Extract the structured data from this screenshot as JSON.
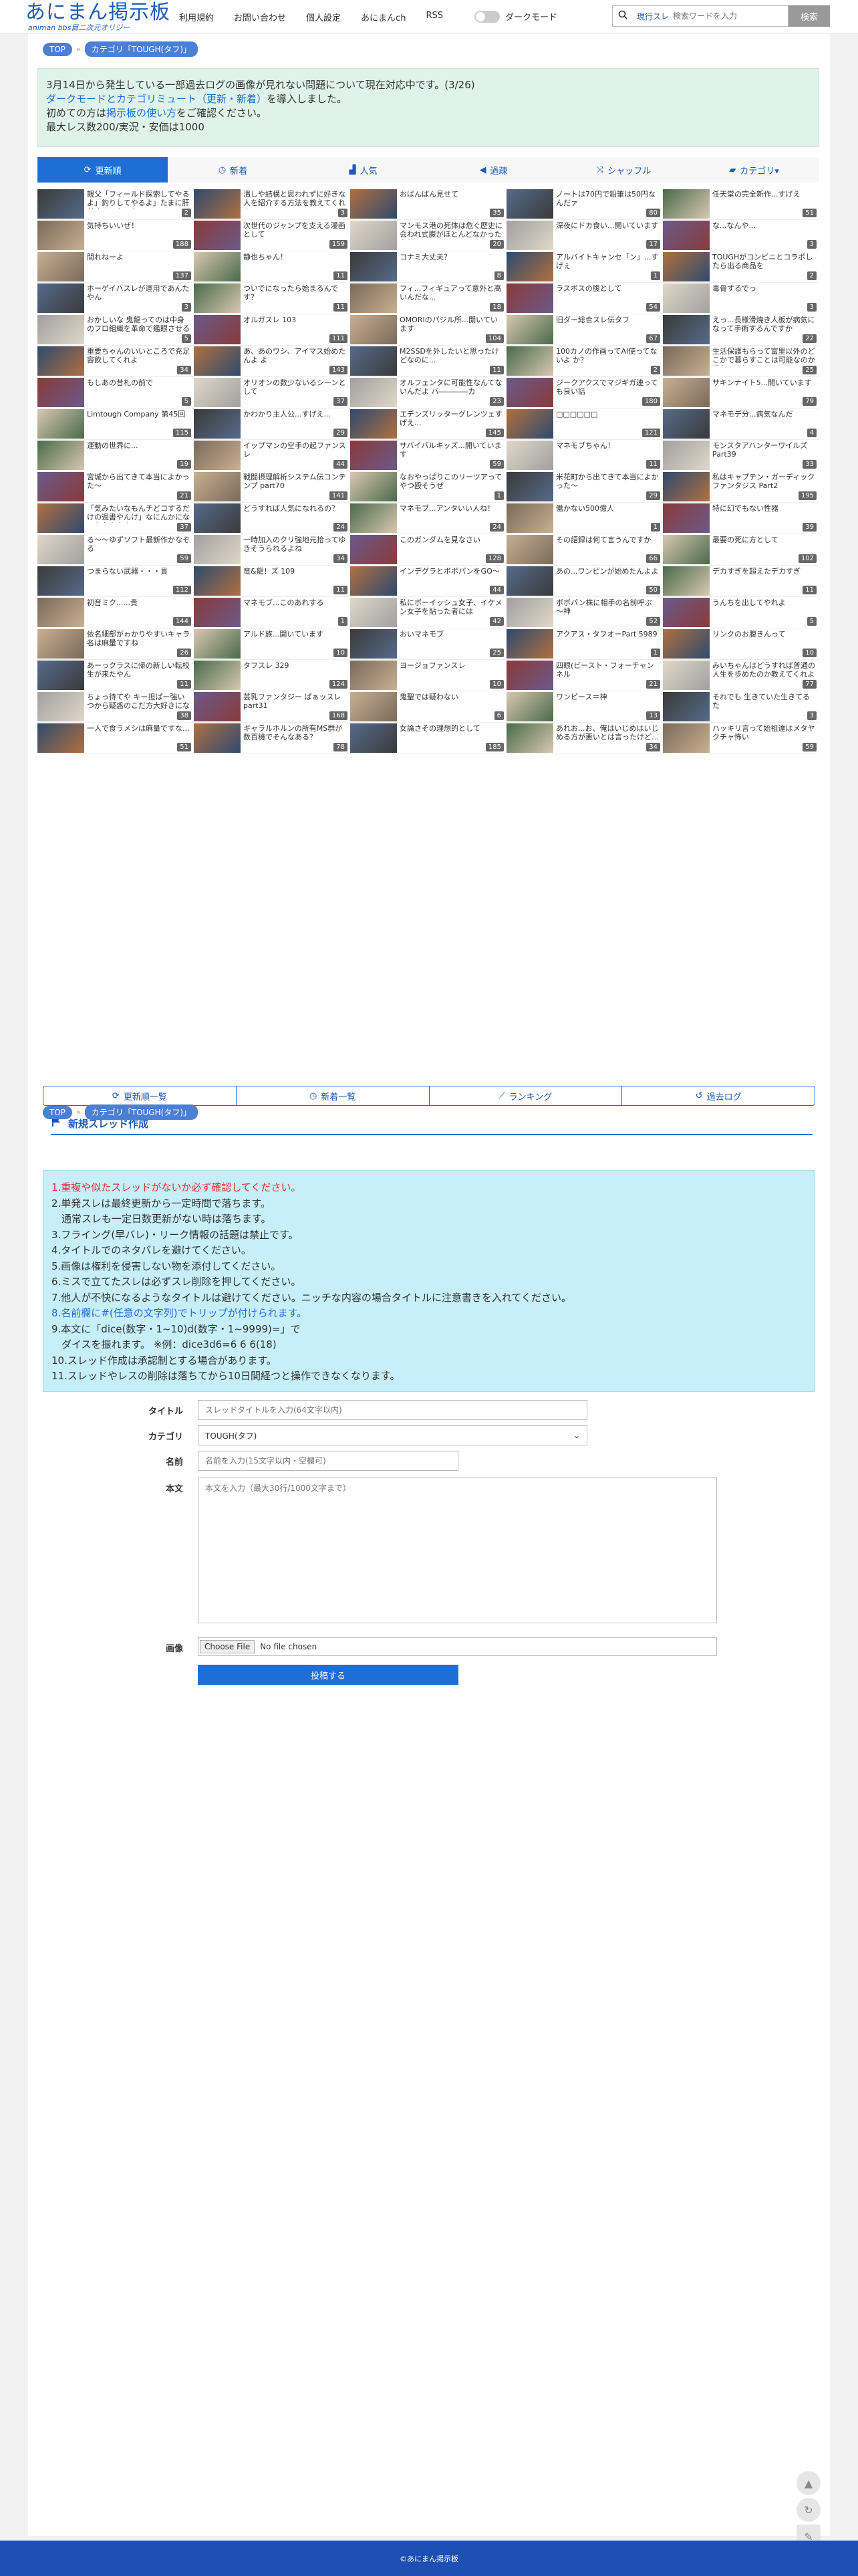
{
  "header": {
    "logo_main": "あにまん掲示板",
    "logo_sub": "animan bbs目二次元オリジー",
    "nav": [
      "利用規約",
      "お問い合わせ",
      "個人設定",
      "あにまんch",
      "RSS"
    ],
    "dark_mode_label": "ダークモード",
    "search_scope": "現行スレ",
    "search_placeholder": "検索ワードを入力",
    "search_button": "検索"
  },
  "breadcrumb": {
    "top": "TOP",
    "category": "カテゴリ「TOUGH(タフ)」"
  },
  "notice": {
    "line1": "3月14日から発生している一部過去ログの画像が見れない問題について現在対応中です。(3/26)",
    "line2_link": "ダークモードとカテゴリミュート（更新・新着）",
    "line2_rest": "を導入しました。",
    "line3_pre": "初めての方は",
    "line3_link": "掲示板の使い方",
    "line3_post": "をご確認ください。",
    "line4": "最大レス数200/実況・安価は1000"
  },
  "tabs": [
    {
      "label": "更新順",
      "icon": "refresh-icon"
    },
    {
      "label": "新着",
      "icon": "clock-icon"
    },
    {
      "label": "人気",
      "icon": "bar-chart-icon"
    },
    {
      "label": "過疎",
      "icon": "speaker-icon"
    },
    {
      "label": "シャッフル",
      "icon": "shuffle-icon"
    },
    {
      "label": "カテゴリ▾",
      "icon": "folder-icon"
    }
  ],
  "threads": [
    {
      "t": "親父「フィールド探索してやるよ」釣りしてやるよ」たまに肝付するのもワケ?",
      "c": "2"
    },
    {
      "t": "潰しや結構と思われずに好きな人を紹介する方法を教えてくれよ",
      "c": "3"
    },
    {
      "t": "おばんばん見せて",
      "c": "35"
    },
    {
      "t": "ノートは70円で鉛筆は50円なんだァ",
      "c": "80"
    },
    {
      "t": "任天堂の完全新作...すげえ",
      "c": "51"
    },
    {
      "t": "気持ちいいぜ！",
      "c": "188"
    },
    {
      "t": "次世代のジャンプを支える漫画として",
      "c": "159"
    },
    {
      "t": "マンモス港の死体は危ぐ歴史に会われ式腹がほとんどなかったらしい",
      "c": "20"
    },
    {
      "t": "深夜にドカ食い...開いています",
      "c": "17"
    },
    {
      "t": "な...なんや...",
      "c": "3"
    },
    {
      "t": "間れねーよ",
      "c": "137"
    },
    {
      "t": "静也ちゃん！",
      "c": "11"
    },
    {
      "t": "コナミ大丈夫？",
      "c": "8"
    },
    {
      "t": "アルバイトキャンセ「ン」...すげぇ",
      "c": "1"
    },
    {
      "t": "TOUGHがコンビニとコラボしたら出る商品を",
      "c": "2"
    },
    {
      "t": "ホーゲイハスレが運用であんたやん",
      "c": "3"
    },
    {
      "t": "ついでになったら始まるんです？",
      "c": "11"
    },
    {
      "t": "フィ...フィギュアって意外と高いんだな...",
      "c": "18"
    },
    {
      "t": "ラスボスの腹として",
      "c": "54"
    },
    {
      "t": "毒骨するでっ",
      "c": "3"
    },
    {
      "t": "おかしいな 鬼龍ってのは中身のフロ組織を革命で鑑眼させるんだ？",
      "c": "5"
    },
    {
      "t": "オルガスレ 103",
      "c": "111"
    },
    {
      "t": "OMORIのパジル所...開いています",
      "c": "104"
    },
    {
      "t": "旧ダー総合スレ伝タフ",
      "c": "67"
    },
    {
      "t": "えっ...長様滑焼き人板が病気になって手術するんですか",
      "c": "22"
    },
    {
      "t": "重要ちゃんのいいところで充足容飲してくれよ",
      "c": "34"
    },
    {
      "t": "あ、あのワシ、アイマス始めたんよ よ",
      "c": "143"
    },
    {
      "t": "M2SSDを外したいと思ったけどなのに...",
      "c": "11"
    },
    {
      "t": "100カノの作画ってAI使ってないよ か？",
      "c": "2"
    },
    {
      "t": "生活保護もらって富里以外のどこかで暮らすことは可能なのか教えてくれよ",
      "c": "25"
    },
    {
      "t": "もしあの昔札の前で",
      "c": "5"
    },
    {
      "t": "オリオンの数少ないるシーンとして",
      "c": "37"
    },
    {
      "t": "オルフェンタに可能性なんてないんだよ バ――――カ",
      "c": "23"
    },
    {
      "t": "ジークアクスでマジギガ連っても良い話",
      "c": "180"
    },
    {
      "t": "サキンナイト5...開いています",
      "c": "79"
    },
    {
      "t": "Limtough Company 第45回",
      "c": "115"
    },
    {
      "t": "かわかり主人公...すげえ...",
      "c": "29"
    },
    {
      "t": "エデンズリッターグレンツェすげえ...",
      "c": "145"
    },
    {
      "t": "□□□□□□",
      "c": "121"
    },
    {
      "t": "マネモデ分...病気なんだ",
      "c": "4"
    },
    {
      "t": "運動の世界に...",
      "c": "19"
    },
    {
      "t": "イップマンの空手の起ファンスレ",
      "c": "44"
    },
    {
      "t": "サバイバルキッズ...開いています",
      "c": "59"
    },
    {
      "t": "マネモブちゃん！",
      "c": "11"
    },
    {
      "t": "モンスタアハンターワイルズ Part39",
      "c": "33"
    },
    {
      "t": "宮城から出てきて本当によかった～",
      "c": "21"
    },
    {
      "t": "戦闘摂理解析システム伝コンテンプ part70",
      "c": "141"
    },
    {
      "t": "なおやっぱりこのリーツアってやつ殴そうぜ",
      "c": "1"
    },
    {
      "t": "米花町から出てきて本当によかった～",
      "c": "29"
    },
    {
      "t": "私はキャプテン・ガーディックファンタジス Part2",
      "c": "195"
    },
    {
      "t": "「気みたいなもんチどコするだけの週書やんけ」なにんかになったもんやん",
      "c": "37"
    },
    {
      "t": "どうすれば人気になれるの？",
      "c": "24"
    },
    {
      "t": "マネモブ...アンタいい人ね！",
      "c": "24"
    },
    {
      "t": "働かない500億人",
      "c": "1"
    },
    {
      "t": "特に幻でもない性器",
      "c": "39"
    },
    {
      "t": "る～～ゆずソフト最新作かなぞる",
      "c": "59"
    },
    {
      "t": "一時加入のクリ強地元拾ってゆきそうられるよね",
      "c": "34"
    },
    {
      "t": "このガンダムを見なさい",
      "c": "128"
    },
    {
      "t": "その語録は何て言うんですか",
      "c": "66"
    },
    {
      "t": "最要の死に方として",
      "c": "102"
    },
    {
      "t": "つまらない武器・・・貴",
      "c": "112"
    },
    {
      "t": "竜&龍！ズ 109",
      "c": "11"
    },
    {
      "t": "インデグラとボボパンをGO～",
      "c": "44"
    },
    {
      "t": "あの...ワンピンが始めたんよよ",
      "c": "50"
    },
    {
      "t": "デカすぎを超えたデカすぎ",
      "c": "11"
    },
    {
      "t": "初音ミク......貴",
      "c": "144"
    },
    {
      "t": "マネモブ...このあれする",
      "c": "1"
    },
    {
      "t": "私にボーイッシュ女子、イケメン女子を貼った者には",
      "c": "42"
    },
    {
      "t": "ボボパン株に相手の名前呼ぶ～神",
      "c": "52"
    },
    {
      "t": "うんちを出してやれよ",
      "c": "5"
    },
    {
      "t": "依名細部がゎかりやすいキャラ名は麻量ですね",
      "c": "26"
    },
    {
      "t": "アルド族...開いています",
      "c": "10"
    },
    {
      "t": "おいマネモブ",
      "c": "25"
    },
    {
      "t": "アクアス・タフオーPart 5989",
      "c": "1"
    },
    {
      "t": "リンクのお腹きんって",
      "c": "10"
    },
    {
      "t": "あーっクラスに帰の新しい転校生が来たやん",
      "c": "11"
    },
    {
      "t": "タフスレ 329",
      "c": "124"
    },
    {
      "t": "ヨージョファンスレ",
      "c": "10"
    },
    {
      "t": "四眼(ビースト・フォーチャンネル",
      "c": "21"
    },
    {
      "t": "みいちゃんはどうすれば普通の人生を歩めたのか教えてくれよ",
      "c": "77"
    },
    {
      "t": "ちょっ待てや キー担ぱー強いつから疑惑のこだ方大好きになったんや",
      "c": "38"
    },
    {
      "t": "芸乳ファンタジー ぱぁッスレpart31",
      "c": "168"
    },
    {
      "t": "鬼聖では疑わない",
      "c": "6"
    },
    {
      "t": "ワンピース＝神",
      "c": "13"
    },
    {
      "t": "それでも 生きていた生きてるた",
      "c": "3"
    },
    {
      "t": "一人で食うメシは麻量ですな...",
      "c": "51"
    },
    {
      "t": "ギャラルホルンの所有MS群が数百機でそんなある？",
      "c": "78"
    },
    {
      "t": "女論さその理想的として",
      "c": "185"
    },
    {
      "t": "あれお...お、俺はいじめはいじめる方が悪いとは言ったけど...",
      "c": "34"
    },
    {
      "t": "ハッキリ言って始祖達はメタヤクチャ怖い",
      "c": "59"
    }
  ],
  "bottom_links": [
    {
      "label": "更新順一覧",
      "icon": "refresh-icon"
    },
    {
      "label": "新着一覧",
      "icon": "clock-icon"
    },
    {
      "label": "ランキング",
      "icon": "chart-icon"
    },
    {
      "label": "過去ログ",
      "icon": "history-icon"
    }
  ],
  "new_thread": {
    "title": "新規スレッド作成",
    "rules": [
      {
        "text": "1.重複や似たスレッドがないか必ず確認してください。",
        "style": "red"
      },
      {
        "text": "2.単発スレは最終更新から一定時間で落ちます。",
        "style": ""
      },
      {
        "text": "　通常スレも一定日数更新がない時は落ちます。",
        "style": ""
      },
      {
        "text": "3.フライング(早バレ)・リーク情報の話題は禁止です。",
        "style": ""
      },
      {
        "text": "4.タイトルでのネタバレを避けてください。",
        "style": ""
      },
      {
        "text": "5.画像は権利を侵害しない物を添付してください。",
        "style": ""
      },
      {
        "text": "6.ミスで立てたスレは必ずスレ削除を押してください。",
        "style": ""
      },
      {
        "text": "7.他人が不快になるようなタイトルは避けてください。ニッチな内容の場合タイトルに注意書きを入れてください。",
        "style": ""
      },
      {
        "text": "8.名前欄に#(任意の文字列)でトリップが付けられます。",
        "style": "link"
      },
      {
        "text": "9.本文に「dice(数字・1~10)d(数字・1~9999)=」で",
        "style": ""
      },
      {
        "text": "　ダイスを振れます。 ※例：dice3d6=6 6 6(18)",
        "style": ""
      },
      {
        "text": "10.スレッド作成は承認制とする場合があります。",
        "style": ""
      },
      {
        "text": "11.スレッドやレスの削除は落ちてから10日間経つと操作できなくなります。",
        "style": ""
      }
    ],
    "form": {
      "title_label": "タイトル",
      "title_placeholder": "スレッドタイトルを入力(64文字以内)",
      "category_label": "カテゴリ",
      "category_value": "TOUGH(タフ)",
      "name_label": "名前",
      "name_placeholder": "名前を入力(15文字以内・空欄可)",
      "body_label": "本文",
      "body_placeholder": "本文を入力（最大30行/1000文字まで）",
      "image_label": "画像",
      "file_button": "Choose File",
      "file_status": "No file chosen",
      "submit": "投稿する"
    }
  },
  "footer": {
    "copyright": "©あにまん掲示板"
  }
}
